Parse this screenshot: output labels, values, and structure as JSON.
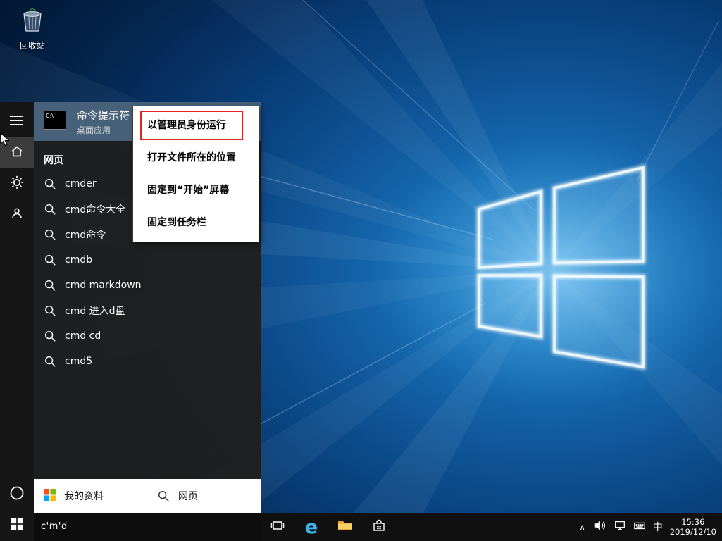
{
  "desktop": {
    "recycle_bin_label": "回收站"
  },
  "start_menu": {
    "top_result": {
      "title": "命令提示符",
      "subtitle": "桌面应用"
    },
    "section_label": "网页",
    "suggestions": [
      "cmder",
      "cmd命令大全",
      "cmd命令",
      "cmdb",
      "cmd markdown",
      "cmd 进入d盘",
      "cmd cd",
      "cmd5"
    ],
    "footer": {
      "my_stuff": "我的资料",
      "web": "网页"
    },
    "search_input": {
      "value": "c'm'd"
    }
  },
  "context_menu": {
    "items": [
      "以管理员身份运行",
      "打开文件所在的位置",
      "固定到“开始”屏幕",
      "固定到任务栏"
    ]
  },
  "taskbar": {
    "edge_glyph": "e",
    "tray": {
      "chevron": "∧",
      "ime": "中",
      "time": "15:36",
      "date": "2019/12/10"
    }
  },
  "icons": {
    "cmd_glyph": "C:\\"
  },
  "colors": {
    "top_result_highlight": "#47617a",
    "annotation_red": "#e8231e",
    "panel_bg": "#1f1f1f",
    "taskbar_bg": "#101010",
    "menu_bg": "#ffffff"
  }
}
